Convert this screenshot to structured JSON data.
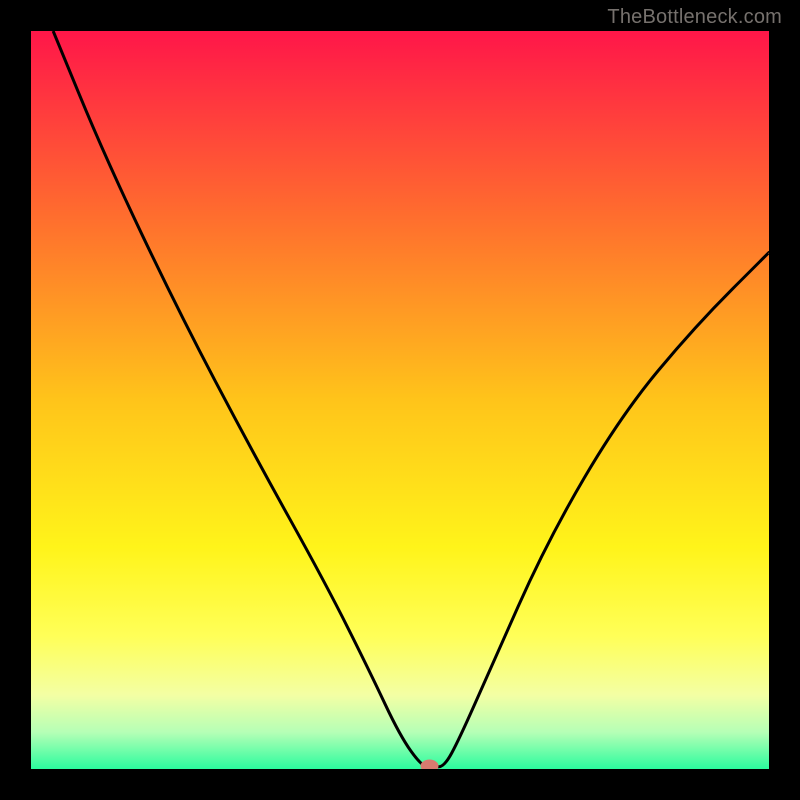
{
  "attribution": "TheBottleneck.com",
  "chart_data": {
    "type": "line",
    "title": "",
    "xlabel": "",
    "ylabel": "",
    "xlim": [
      0,
      100
    ],
    "ylim": [
      0,
      100
    ],
    "x": [
      3,
      10,
      20,
      30,
      40,
      46,
      50,
      53,
      54.5,
      56,
      58,
      62,
      70,
      80,
      90,
      100
    ],
    "values": [
      100,
      83,
      62,
      43,
      25,
      13,
      4.5,
      0.3,
      0.3,
      0.3,
      4,
      13,
      31,
      48,
      60,
      70
    ],
    "marker": {
      "x": 54,
      "y": 0.4,
      "color": "#d77b6f"
    },
    "gradient_stops": [
      {
        "offset": 0.0,
        "color": "#ff1649"
      },
      {
        "offset": 0.25,
        "color": "#ff6d2e"
      },
      {
        "offset": 0.5,
        "color": "#ffc41a"
      },
      {
        "offset": 0.7,
        "color": "#fff41a"
      },
      {
        "offset": 0.82,
        "color": "#ffff58"
      },
      {
        "offset": 0.9,
        "color": "#f3ffa4"
      },
      {
        "offset": 0.95,
        "color": "#b6ffb6"
      },
      {
        "offset": 1.0,
        "color": "#2bfc9e"
      }
    ],
    "line_color": "#000000",
    "line_width": 3
  }
}
